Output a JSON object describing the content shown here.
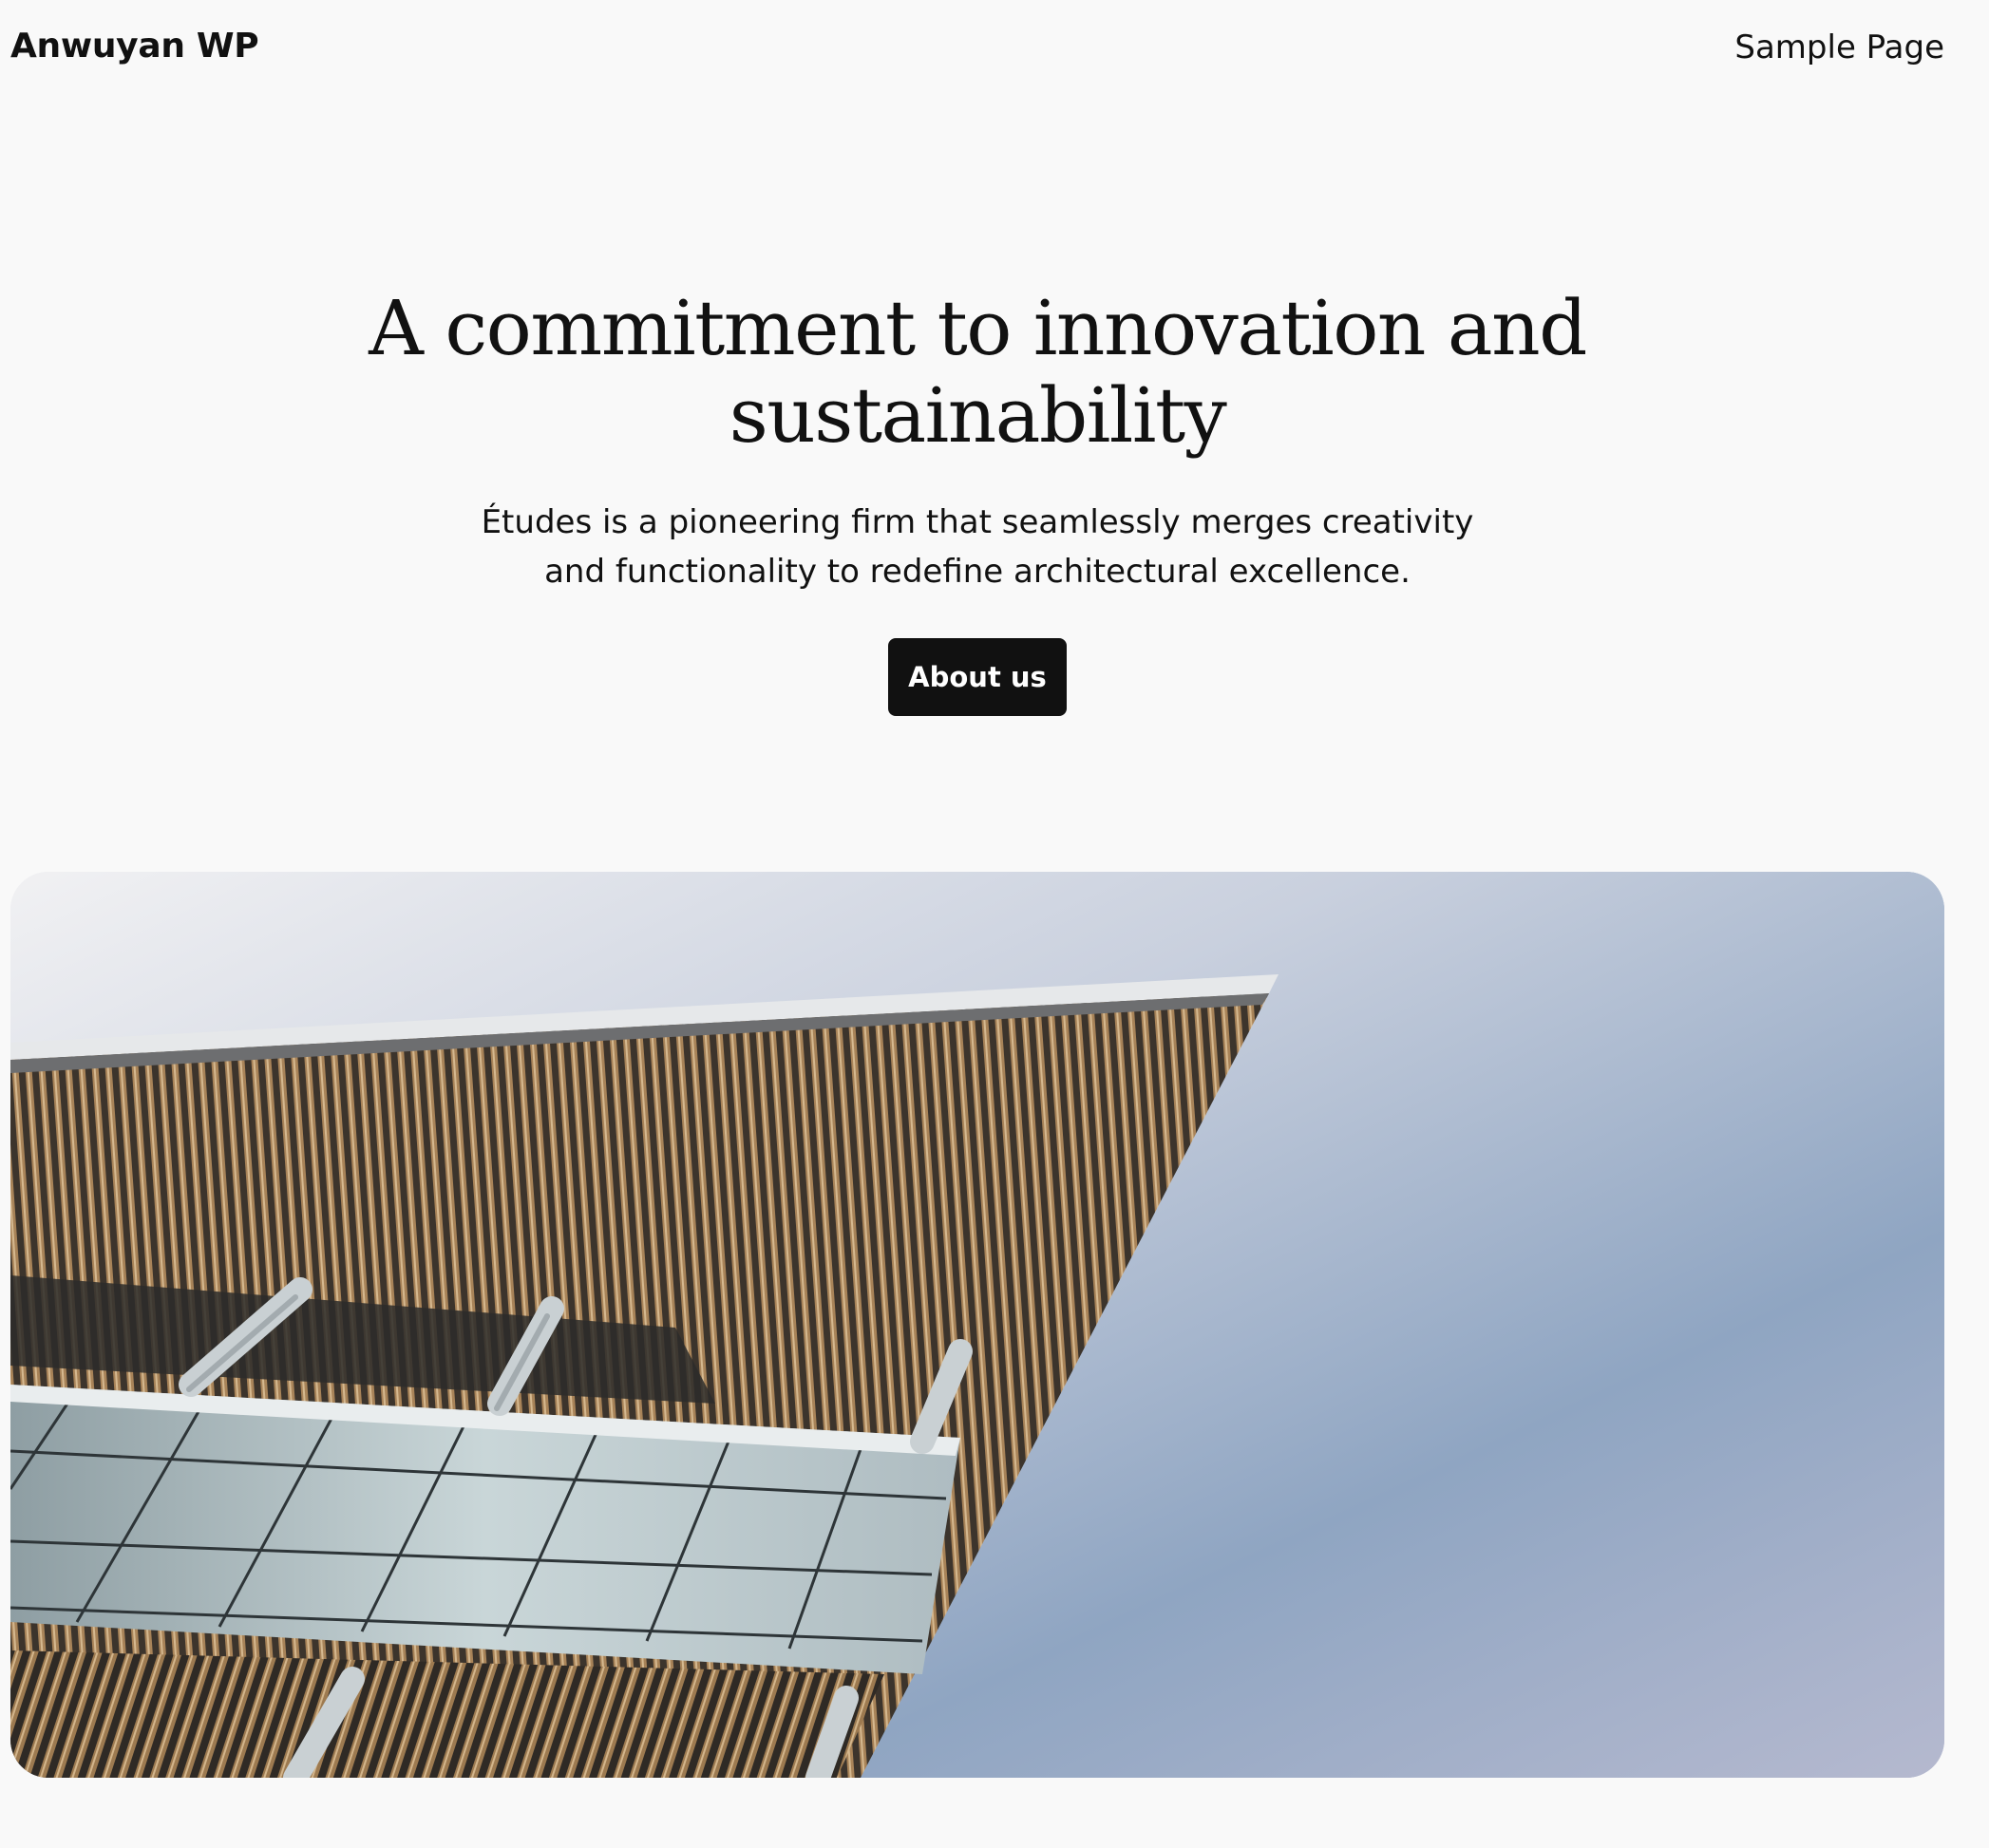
{
  "header": {
    "site_title": "Anwuyan WP",
    "nav": [
      {
        "label": "Sample Page"
      }
    ]
  },
  "hero": {
    "heading": "A commitment to innovation and sustainability",
    "description": "Études is a pioneering firm that seamlessly merges creativity and functionality to redefine architectural excellence.",
    "button_label": "About us"
  },
  "image": {
    "subject": "building-canopy-photo",
    "colors": {
      "sky": "#9fb1cb",
      "slats": "#8a6a44",
      "glass": "#b9c7cc"
    }
  }
}
